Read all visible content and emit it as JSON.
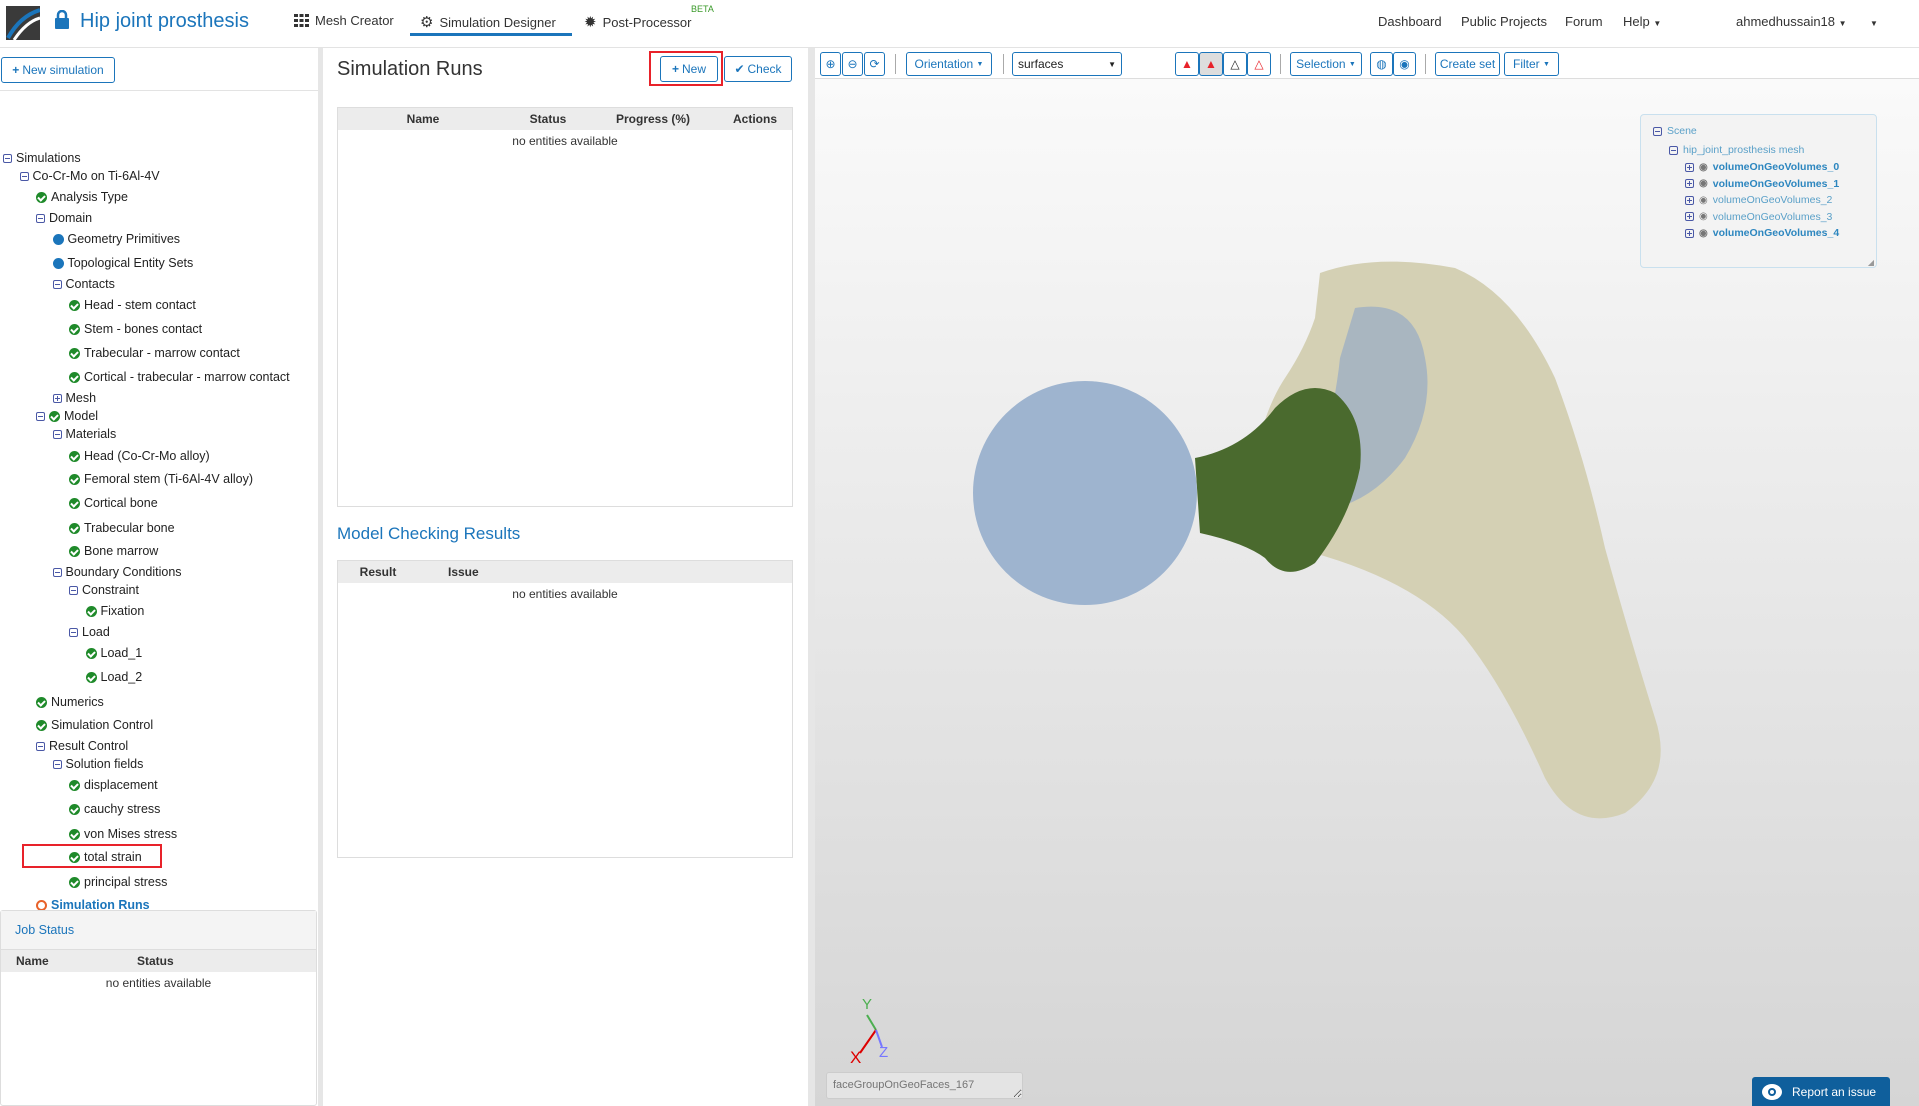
{
  "header": {
    "project_title": "Hip joint prosthesis",
    "tabs": [
      {
        "label": "Mesh Creator"
      },
      {
        "label": "Simulation Designer",
        "active": true
      },
      {
        "label": "Post-Processor",
        "badge": "BETA"
      }
    ],
    "right_links": [
      "Dashboard",
      "Public Projects",
      "Forum",
      "Help"
    ],
    "user": "ahmedhussain18"
  },
  "left": {
    "new_simulation": "New simulation",
    "tree": [
      {
        "label": "Simulations",
        "level": 0,
        "icon": "minus"
      },
      {
        "label": "Co-Cr-Mo on Ti-6Al-4V",
        "level": 1,
        "icon": "minus"
      },
      {
        "label": "Analysis Type",
        "level": 2,
        "icon": "check"
      },
      {
        "label": "Domain",
        "level": 2,
        "icon": "minus"
      },
      {
        "label": "Geometry Primitives",
        "level": 3,
        "icon": "dot"
      },
      {
        "label": "Topological Entity Sets",
        "level": 3,
        "icon": "dot"
      },
      {
        "label": "Contacts",
        "level": 3,
        "icon": "minus"
      },
      {
        "label": "Head - stem contact",
        "level": 4,
        "icon": "check"
      },
      {
        "label": "Stem - bones contact",
        "level": 4,
        "icon": "check"
      },
      {
        "label": "Trabecular - marrow contact",
        "level": 4,
        "icon": "check"
      },
      {
        "label": "Cortical - trabecular - marrow contact",
        "level": 4,
        "icon": "check"
      },
      {
        "label": "Mesh",
        "level": 3,
        "icon": "plus"
      },
      {
        "label": "Model",
        "level": 2,
        "icon": "minus-check"
      },
      {
        "label": "Materials",
        "level": 3,
        "icon": "minus"
      },
      {
        "label": "Head (Co-Cr-Mo alloy)",
        "level": 4,
        "icon": "check"
      },
      {
        "label": "Femoral stem (Ti-6Al-4V alloy)",
        "level": 4,
        "icon": "check"
      },
      {
        "label": "Cortical bone",
        "level": 4,
        "icon": "check"
      },
      {
        "label": "Trabecular bone",
        "level": 4,
        "icon": "check"
      },
      {
        "label": "Bone marrow",
        "level": 4,
        "icon": "check"
      },
      {
        "label": "Boundary Conditions",
        "level": 3,
        "icon": "minus"
      },
      {
        "label": "Constraint",
        "level": 4,
        "icon": "minus"
      },
      {
        "label": "Fixation",
        "level": 5,
        "icon": "check"
      },
      {
        "label": "Load",
        "level": 4,
        "icon": "minus"
      },
      {
        "label": "Load_1",
        "level": 5,
        "icon": "check"
      },
      {
        "label": "Load_2",
        "level": 5,
        "icon": "check"
      },
      {
        "label": "Numerics",
        "level": 2,
        "icon": "check"
      },
      {
        "label": "Simulation Control",
        "level": 2,
        "icon": "check"
      },
      {
        "label": "Result Control",
        "level": 2,
        "icon": "minus"
      },
      {
        "label": "Solution fields",
        "level": 3,
        "icon": "minus"
      },
      {
        "label": "displacement",
        "level": 4,
        "icon": "check"
      },
      {
        "label": "cauchy stress",
        "level": 4,
        "icon": "check"
      },
      {
        "label": "von Mises stress",
        "level": 4,
        "icon": "check"
      },
      {
        "label": "total strain",
        "level": 4,
        "icon": "check"
      },
      {
        "label": "principal stress",
        "level": 4,
        "icon": "check"
      },
      {
        "label": "Simulation Runs",
        "level": 2,
        "icon": "ring",
        "selected": true
      }
    ],
    "job_status": {
      "title": "Job Status",
      "columns": [
        "Name",
        "Status"
      ],
      "empty": "no entities available"
    }
  },
  "middle": {
    "title": "Simulation Runs",
    "new_label": "New",
    "check_label": "Check",
    "runs_table": {
      "columns": [
        "Name",
        "Status",
        "Progress (%)",
        "Actions"
      ],
      "empty": "no entities available"
    },
    "checking_title": "Model Checking Results",
    "checking_table": {
      "columns": [
        "Result",
        "Issue"
      ],
      "empty": "no entities available"
    }
  },
  "viewer": {
    "orientation": "Orientation",
    "render_mode": "surfaces",
    "selection": "Selection",
    "create_set": "Create set",
    "filter": "Filter",
    "scene": {
      "root": "Scene",
      "mesh": "hip_joint_prosthesis mesh",
      "volumes": [
        {
          "label": "volumeOnGeoVolumes_0",
          "bold": true
        },
        {
          "label": "volumeOnGeoVolumes_1",
          "bold": true
        },
        {
          "label": "volumeOnGeoVolumes_2",
          "bold": false
        },
        {
          "label": "volumeOnGeoVolumes_3",
          "bold": false
        },
        {
          "label": "volumeOnGeoVolumes_4",
          "bold": true
        }
      ]
    },
    "axes": {
      "x": "X",
      "y": "Y",
      "z": "Z"
    },
    "face_group_placeholder": "faceGroupOnGeoFaces_167",
    "report_issue": "Report an issue"
  },
  "colors": {
    "accent": "#1b75bb",
    "check": "#1f8a2a",
    "highlight": "#e8222a"
  }
}
